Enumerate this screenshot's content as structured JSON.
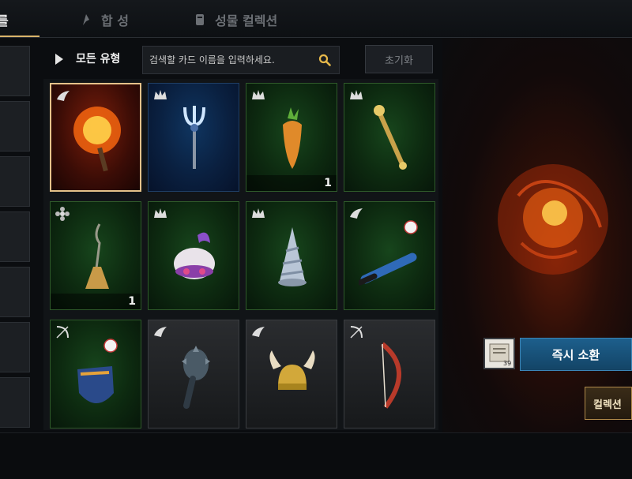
{
  "tabs": [
    {
      "label": "를",
      "active": true
    },
    {
      "label": "합 성",
      "icon": "synthesis-icon",
      "active": false
    },
    {
      "label": "성물 컬렉션",
      "icon": "collection-icon",
      "active": false
    }
  ],
  "filter": {
    "type_label": "모든 유형",
    "search_placeholder": "검색할 카드 이름을 입력하세요.",
    "reset_label": "초기화"
  },
  "cards": [
    {
      "item": "flame-torch",
      "badge": "wing-badge-icon",
      "bg": "red",
      "count": ""
    },
    {
      "item": "trident",
      "badge": "crown-badge-icon",
      "bg": "blue",
      "count": ""
    },
    {
      "item": "carrot",
      "badge": "crown-badge-icon",
      "bg": "green",
      "count": "1"
    },
    {
      "item": "golden-scepter",
      "badge": "crown-badge-icon",
      "bg": "green",
      "count": ""
    },
    {
      "item": "broom",
      "badge": "flower-badge-icon",
      "bg": "green",
      "count": "1"
    },
    {
      "item": "feather-hat",
      "badge": "crown-badge-icon",
      "bg": "green",
      "count": ""
    },
    {
      "item": "cone-hat",
      "badge": "crown-badge-icon",
      "bg": "green",
      "count": ""
    },
    {
      "item": "baseball-bat",
      "badge": "wing-badge-icon",
      "bg": "green",
      "count": ""
    },
    {
      "item": "baseball-glove",
      "badge": "bow-badge-icon",
      "bg": "green",
      "count": ""
    },
    {
      "item": "spiked-mace",
      "badge": "wing-badge-icon",
      "bg": "gray",
      "count": ""
    },
    {
      "item": "horned-helmet",
      "badge": "wing-badge-icon",
      "bg": "gray",
      "count": ""
    },
    {
      "item": "red-bow",
      "badge": "bow-badge-icon",
      "bg": "gray",
      "count": ""
    }
  ],
  "summon": {
    "scroll_count": "39",
    "button_label": "즉시 소환",
    "collection_label": "컬렉션"
  },
  "colors": {
    "accent_gold": "#d9b46a",
    "summon_blue": "#1d5f8c",
    "grade_green": "#0d2a10"
  }
}
